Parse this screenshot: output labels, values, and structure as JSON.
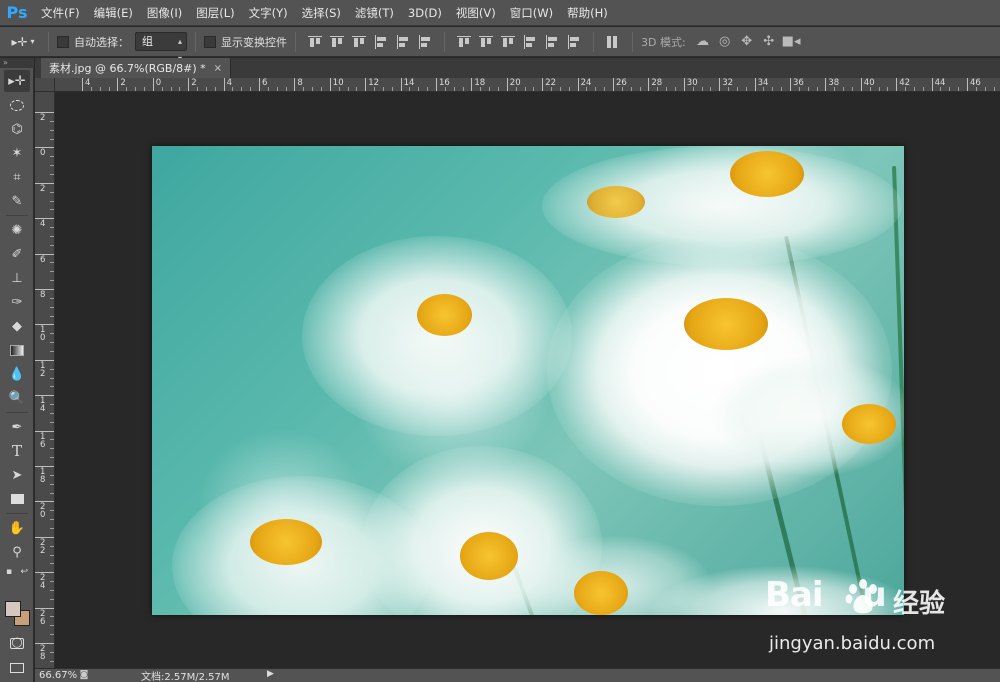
{
  "app": {
    "logo": "Ps"
  },
  "menu": [
    "文件(F)",
    "编辑(E)",
    "图像(I)",
    "图层(L)",
    "文字(Y)",
    "选择(S)",
    "滤镜(T)",
    "3D(D)",
    "视图(V)",
    "窗口(W)",
    "帮助(H)"
  ],
  "options": {
    "auto_select_label": "自动选择：",
    "auto_select_value": "组",
    "show_transform_label": "显示变换控件",
    "mode3d_label": "3D 模式:"
  },
  "document": {
    "tab_title": "素材.jpg @ 66.7%(RGB/8#) *",
    "close_glyph": "×"
  },
  "rulers": {
    "h_labels": [
      "4",
      "2",
      "0",
      "2",
      "4",
      "6",
      "8",
      "10",
      "12",
      "14",
      "16",
      "18",
      "20",
      "22",
      "24",
      "26",
      "28",
      "30",
      "32",
      "34",
      "36",
      "38",
      "40",
      "42",
      "44",
      "46"
    ],
    "v_labels": [
      "2",
      "0",
      "2",
      "4",
      "6",
      "8",
      "10",
      "12",
      "14",
      "16",
      "18",
      "20",
      "22",
      "24",
      "26",
      "28"
    ]
  },
  "status": {
    "zoom": "66.67%",
    "doc_size": "文档:2.57M/2.57M"
  },
  "watermark": {
    "logo_text": "Bai",
    "logo_suffix": "u",
    "jingyan": "经验",
    "url": "jingyan.baidu.com"
  },
  "colors": {
    "foreground": "#d5c6c0",
    "background": "#c7a07a",
    "accent": "#31a8ff"
  }
}
